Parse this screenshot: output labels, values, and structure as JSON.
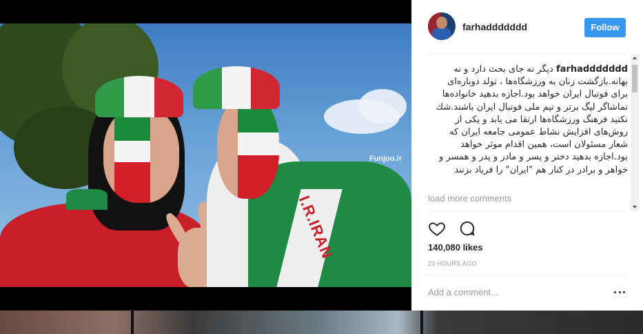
{
  "post": {
    "username": "farhaddddddd",
    "follow_label": "Follow",
    "caption_username": "farhaddddddd",
    "caption_text": "دیگر نه جای بحث دارد و نه بهانه.بازگشت زنان به ورزشگاه‌ها ، تولد دوباره‌ای برای فوتبال ایران خواهد بود.اجازه بدهید خانواده‌ها تماشاگر لیگ برتر و تیم ملی فوتبال ایران باشند.شك نكنید فرهنگ ورزشگاه‌ها ارتقا می یابد و یكی از روش‌های افزایش نشاط عمومی جامعه ایران كه شعار مسئولان است، همین اقدام موثر خواهد بود.اجازه بدهید دختر و پسر و مادر و پدر و همسر و خواهر و برادر در کنار هم \"ایران\" را فریاد بزنند",
    "load_more": "load more comments",
    "likes": "140,080 likes",
    "time_ago": "20 HOURS AGO",
    "comment_placeholder": "Add a comment..."
  },
  "photo": {
    "watermark": "Funjoo.ir",
    "scarf_text": "I.R.IRAN"
  },
  "icons": {
    "like": "heart-icon",
    "comment": "speech-bubble-icon",
    "more": "more-options-icon"
  },
  "colors": {
    "follow_button": "#3897f0",
    "text_primary": "#262626",
    "text_muted": "#999999"
  }
}
